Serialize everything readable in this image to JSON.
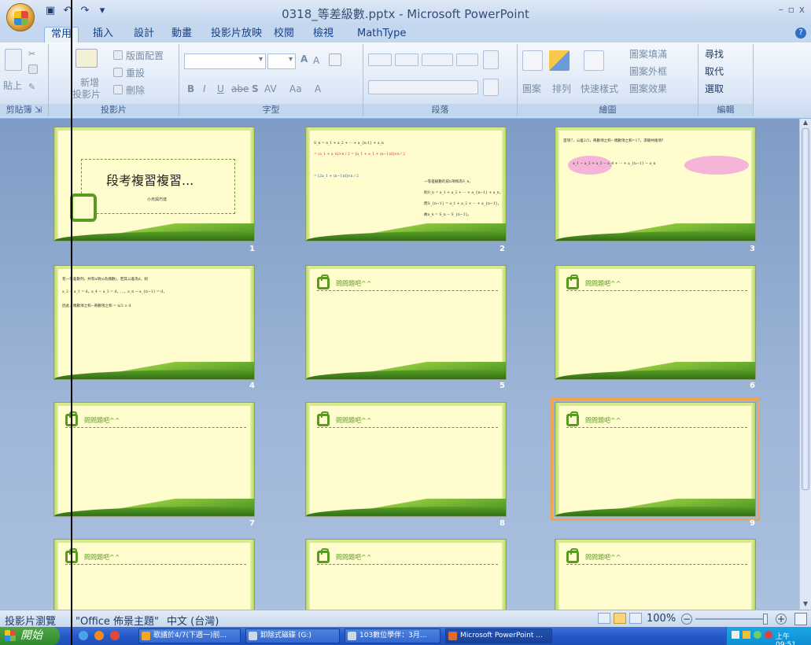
{
  "window": {
    "title": "0318_等差級數.pptx - Microsoft PowerPoint",
    "controls": [
      "–",
      "▫",
      "x"
    ]
  },
  "tabs": [
    "常用",
    "插入",
    "設計",
    "動畫",
    "投影片放映",
    "校閱",
    "檢視",
    "MathType"
  ],
  "active_tab": "常用",
  "ribbon": {
    "clipboard": {
      "label": "剪貼簿",
      "paste": "貼上"
    },
    "slides": {
      "label": "投影片",
      "new_slide": "新增",
      "new_slide2": "投影片",
      "layout": "版面配置",
      "reset": "重設",
      "delete": "刪除"
    },
    "font": {
      "label": "字型",
      "bold": "B",
      "italic": "I",
      "underline": "U",
      "strike": "abe",
      "shadow": "S",
      "spacing": "AV",
      "case": "Aa",
      "color": "A",
      "grow": "A",
      "shrink": "A"
    },
    "paragraph": {
      "label": "段落"
    },
    "drawing": {
      "label": "繪圖",
      "shapes": "圖案",
      "arrange": "排列",
      "quick_styles": "快速樣式",
      "fill": "圖案填滿",
      "outline": "圖案外框",
      "effects": "圖案效果"
    },
    "editing": {
      "label": "編輯",
      "find": "尋找",
      "replace": "取代",
      "select": "選取"
    }
  },
  "slides": [
    {
      "num": "1",
      "title": "段考複習複習...",
      "subtitle": "小烏與巧達"
    },
    {
      "num": "2",
      "lines": [
        "S_n = a_1 + a_2 + ··· + a_{n-1} + a_n",
        "= (a_1 + a_n)×n / 2 = [a_1 + a_1 + (n−1)d]×n / 2",
        "= [2a_1 + (n−1)d]×n / 2",
        "一等差級數的前n項和為S_n，",
        "則S_n = a_1 + a_2 + ··· + a_{n−1} + a_n，",
        "而S_{n−1} = a_1 + a_2 + ··· + a_{n−1}，",
        "故a_n = S_n − S_{n−1}。"
      ]
    },
    {
      "num": "3",
      "lines": [
        "首項7，公差2/3，奇數項之和−偶數項之和=17，求總共幾項？",
        "a_1 − a_2 + a_3 − a_4 + ··· + a_{n−1} − a_n"
      ]
    },
    {
      "num": "4",
      "lines": [
        "有一等差數列，共有n項(n為偶數)，若其公差為d，則",
        "a_2 − a_1 = d，a_4 − a_3 = d，…，a_n − a_{n−1} = d，",
        "因此，偶數項之和−奇數項之和 = n/2 × d"
      ]
    },
    {
      "num": "5",
      "header": "問問題吧^^"
    },
    {
      "num": "6",
      "header": "問問題吧^^"
    },
    {
      "num": "7",
      "header": "問問題吧^^"
    },
    {
      "num": "8",
      "header": "問問題吧^^"
    },
    {
      "num": "9",
      "header": "問問題吧^^"
    },
    {
      "num": "",
      "header": "問問題吧^^"
    },
    {
      "num": "",
      "header": "問問題吧^^"
    },
    {
      "num": "",
      "header": "問問題吧^^"
    }
  ],
  "selected_slide": "9",
  "status": {
    "view": "投影片瀏覽",
    "theme": "\"Office 佈景主題\"",
    "language": "中文 (台灣)",
    "zoom": "100%"
  },
  "taskbar": {
    "start": "開始",
    "items": [
      "歌譜於4/7(下週一)前...",
      "卸除式磁碟 (G:)",
      "103數位學伴：3月...",
      "Microsoft PowerPoint ..."
    ],
    "clock": "上午 09:51"
  },
  "colors": {
    "accent_selected": "#f2a34d",
    "slide_bg": "#fffccd",
    "slide_green": "#5a9a22"
  }
}
